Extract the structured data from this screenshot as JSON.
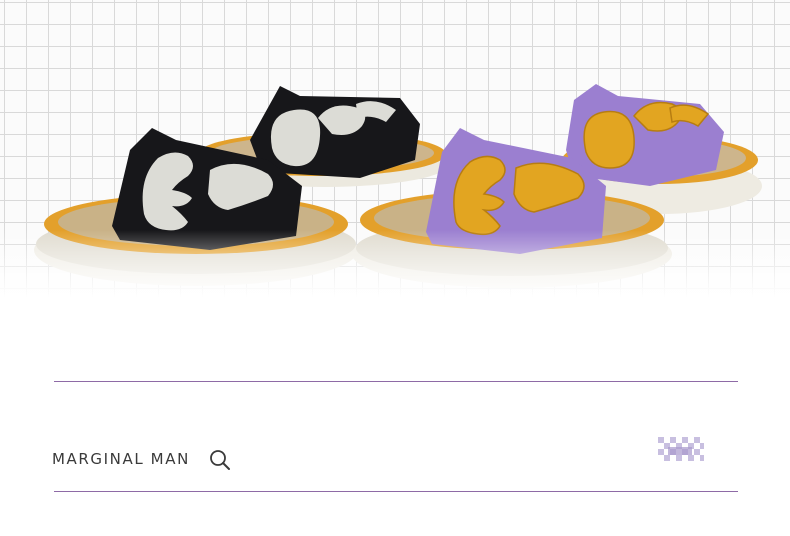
{
  "brand": {
    "name": "MARGINAL MAN"
  },
  "icons": {
    "search": "search-icon",
    "badge": "checkered-logo-icon"
  },
  "colors": {
    "divider": "#8e6aa6",
    "slipper_black": "#17171a",
    "slipper_purple": "#9b7fd0",
    "letter_gray": "#dcdcd6",
    "letter_yellow": "#e2a521",
    "footbed_orange": "#e3a02b",
    "sole_cream": "#eeebe2"
  }
}
